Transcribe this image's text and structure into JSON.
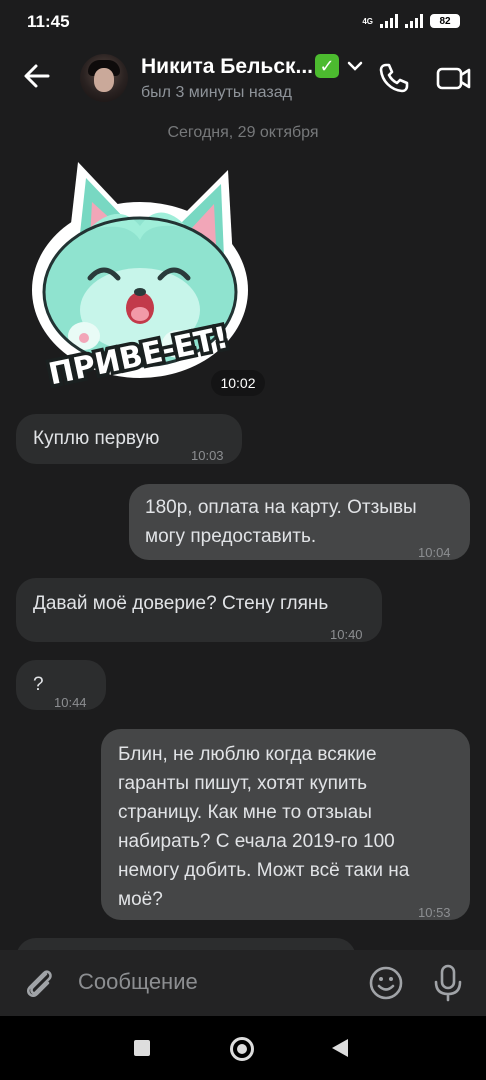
{
  "status_bar": {
    "time": "11:45",
    "network": "4G",
    "battery": "82"
  },
  "header": {
    "contact_name": "Никита Бельск...",
    "verified_badge": "✅",
    "last_seen": "был 3 минуты назад"
  },
  "date_separator": "Сегодня, 29 октября",
  "sticker": {
    "caption": "ПРИВЕ-ЕТ!",
    "time": "10:02"
  },
  "messages": [
    {
      "direction": "incoming",
      "text": "Куплю первую",
      "time": "10:03"
    },
    {
      "direction": "outgoing",
      "text": "180р, оплата на карту. Отзывы\nмогу предоставить.",
      "time": "10:04"
    },
    {
      "direction": "incoming",
      "text": "Давай моё доверие? Стену глянь",
      "time": "10:40"
    },
    {
      "direction": "incoming",
      "text": "?",
      "time": "10:44"
    },
    {
      "direction": "outgoing",
      "text": "Блин, не люблю когда всякие\nгаранты пишут, хотят купить\nстраницу. Как мне то отзыаы\nнабирать? С ечала 2019-го 100\nнемогу добить. Можт всё таки на\nмоё?",
      "time": "10:53"
    }
  ],
  "composer": {
    "placeholder": "Сообщение"
  },
  "colors": {
    "background": "#1c1c1d",
    "incoming_bubble": "#2c2d2e",
    "outgoing_bubble": "#454647",
    "composer": "#232324",
    "verified": "#4cbb2f"
  },
  "icons": [
    "back-arrow-icon",
    "chevron-down-icon",
    "phone-icon",
    "video-camera-icon",
    "paperclip-icon",
    "emoji-icon",
    "microphone-icon"
  ]
}
